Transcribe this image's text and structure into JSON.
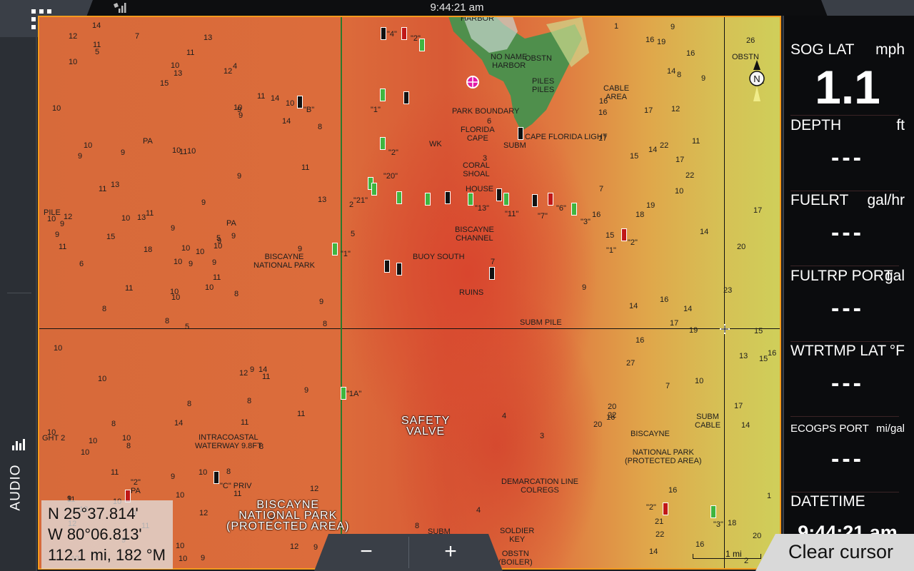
{
  "topbar": {
    "time": "9:44:21 am"
  },
  "left_sidebar": {
    "audio_label": "AUDIO"
  },
  "map": {
    "labels": [
      {
        "text": "NO NAME\nHARBOR"
      },
      {
        "text": "OBSTN"
      },
      {
        "text": "PILES\nPILES"
      },
      {
        "text": "CABLE\nAREA"
      },
      {
        "text": "PARK BOUNDARY"
      },
      {
        "text": "FLORIDA\nCAPE"
      },
      {
        "text": "CAPE FLORIDA LIGHT"
      },
      {
        "text": "SUBM"
      },
      {
        "text": "WK"
      },
      {
        "text": "CORAL\nSHOAL"
      },
      {
        "text": "HOUSE"
      },
      {
        "text": "BISCAYNE\nCHANNEL"
      },
      {
        "text": "BUOY SOUTH"
      },
      {
        "text": "RUINS"
      },
      {
        "text": "SUBM PILE"
      },
      {
        "text": "BISCAYNE\nNATIONAL PARK"
      },
      {
        "text": "PA"
      },
      {
        "text": "PA"
      },
      {
        "text": "PILE"
      },
      {
        "text": "INTRACOASTAL\nWATERWAY 9.8FT"
      },
      {
        "text": "\"C\" PRIV"
      },
      {
        "text": "DEMARCATION LINE\nCOLREGS"
      },
      {
        "text": "SOLDIER\nKEY"
      },
      {
        "text": "OBSTN\n(BOILER)"
      },
      {
        "text": "SUBM"
      },
      {
        "text": "BISCAYNE"
      },
      {
        "text": "NATIONAL PARK\n(PROTECTED AREA)"
      },
      {
        "text": "SUBM\nCABLE"
      },
      {
        "text": "OBSTN"
      },
      {
        "text": "\"2\"\nPA"
      },
      {
        "text": "GHT 2"
      },
      {
        "text": "HARBOR"
      },
      {
        "text": "\"B\""
      },
      {
        "text": "\"1\""
      },
      {
        "text": "\"2\""
      },
      {
        "text": "\"20\""
      },
      {
        "text": "\"21\""
      },
      {
        "text": "\"13\""
      },
      {
        "text": "\"11\""
      },
      {
        "text": "\"7\""
      },
      {
        "text": "\"6\""
      },
      {
        "text": "\"3\""
      },
      {
        "text": "\"1\""
      },
      {
        "text": "\"2\""
      },
      {
        "text": "\"1\""
      },
      {
        "text": "\"1A\""
      },
      {
        "text": "\"2\""
      },
      {
        "text": "\"3\""
      },
      {
        "text": "\"4\""
      },
      {
        "text": "\"2\""
      }
    ],
    "big_labels": [
      {
        "text": "SAFETY\nVALVE"
      },
      {
        "text": "BISCAYNE\nNATIONAL PARK\n(PROTECTED AREA)"
      }
    ],
    "depths": [
      "5",
      "9",
      "10",
      "9",
      "10",
      "8",
      "4",
      "10",
      "9",
      "10",
      "5",
      "9",
      "6",
      "8",
      "8",
      "9",
      "7",
      "10",
      "9",
      "10",
      "11",
      "12",
      "10",
      "11",
      "9",
      "11",
      "10",
      "13",
      "11",
      "12",
      "13",
      "10",
      "9",
      "10",
      "9",
      "11",
      "10",
      "12",
      "12",
      "14",
      "13",
      "13",
      "15",
      "11",
      "9",
      "10",
      "9",
      "12",
      "10",
      "11",
      "10",
      "11",
      "10",
      "8",
      "11",
      "11",
      "11",
      "12",
      "10",
      "10",
      "11",
      "11",
      "12",
      "13",
      "14",
      "14",
      "12",
      "15",
      "10",
      "10",
      "14",
      "11",
      "9",
      "10",
      "11",
      "10",
      "11",
      "10",
      "9",
      "12",
      "10",
      "12",
      "8",
      "9",
      "10",
      "9",
      "8",
      "8",
      "9",
      "8",
      "10",
      "8",
      "9",
      "8",
      "9",
      "11",
      "9",
      "10",
      "10",
      "9",
      "8",
      "7",
      "9",
      "9",
      "10",
      "8",
      "9",
      "5",
      "14",
      "18",
      "15",
      "16",
      "17",
      "16",
      "16",
      "20",
      "17",
      "22",
      "22",
      "19",
      "16",
      "26",
      "22",
      "14",
      "23",
      "27",
      "20",
      "22",
      "20",
      "17",
      "22",
      "16",
      "18",
      "17",
      "15",
      "17",
      "16",
      "20",
      "16",
      "19",
      "19",
      "15",
      "14",
      "14",
      "14",
      "16",
      "21",
      "18",
      "16",
      "14",
      "17",
      "15",
      "16",
      "14",
      "13",
      "16",
      "12",
      "10",
      "14",
      "11",
      "10",
      "8",
      "9",
      "9",
      "9",
      "7",
      "7",
      "1",
      "1",
      "2",
      "3",
      "4",
      "5",
      "6",
      "7",
      "8",
      "3",
      "4",
      "2"
    ],
    "scale_label": "1 mi",
    "compass_label": "N"
  },
  "cursor_info": {
    "lat": "N  25°37.814'",
    "lon": "W  80°06.813'",
    "range_bearing": "112.1 mi, 182 °M"
  },
  "zoom": {
    "out_label": "−",
    "in_label": "+"
  },
  "data_panel": {
    "items": [
      {
        "name": "SOG LAT",
        "unit": "mph",
        "value": "1.1"
      },
      {
        "name": "DEPTH",
        "unit": "ft",
        "value": "---"
      },
      {
        "name": "FUELRT",
        "unit": "gal/hr",
        "value": "---"
      },
      {
        "name": "FULTRP PORT",
        "unit": "gal",
        "value": "---"
      },
      {
        "name": "WTRTMP LAT",
        "unit": "°F",
        "value": "---"
      },
      {
        "name": "ECOGPS PORT",
        "unit": "mi/gal",
        "value": "---"
      },
      {
        "name": "DATETIME",
        "unit": "",
        "value": "9:44:21 am"
      }
    ]
  },
  "clear_cursor_label": "Clear cursor",
  "colors": {
    "accent_orange": "#f39a1d",
    "panel_bg": "#0b0c0e",
    "tab_gray": "#3a3f47",
    "vessel_magenta": "#e21aa8"
  }
}
